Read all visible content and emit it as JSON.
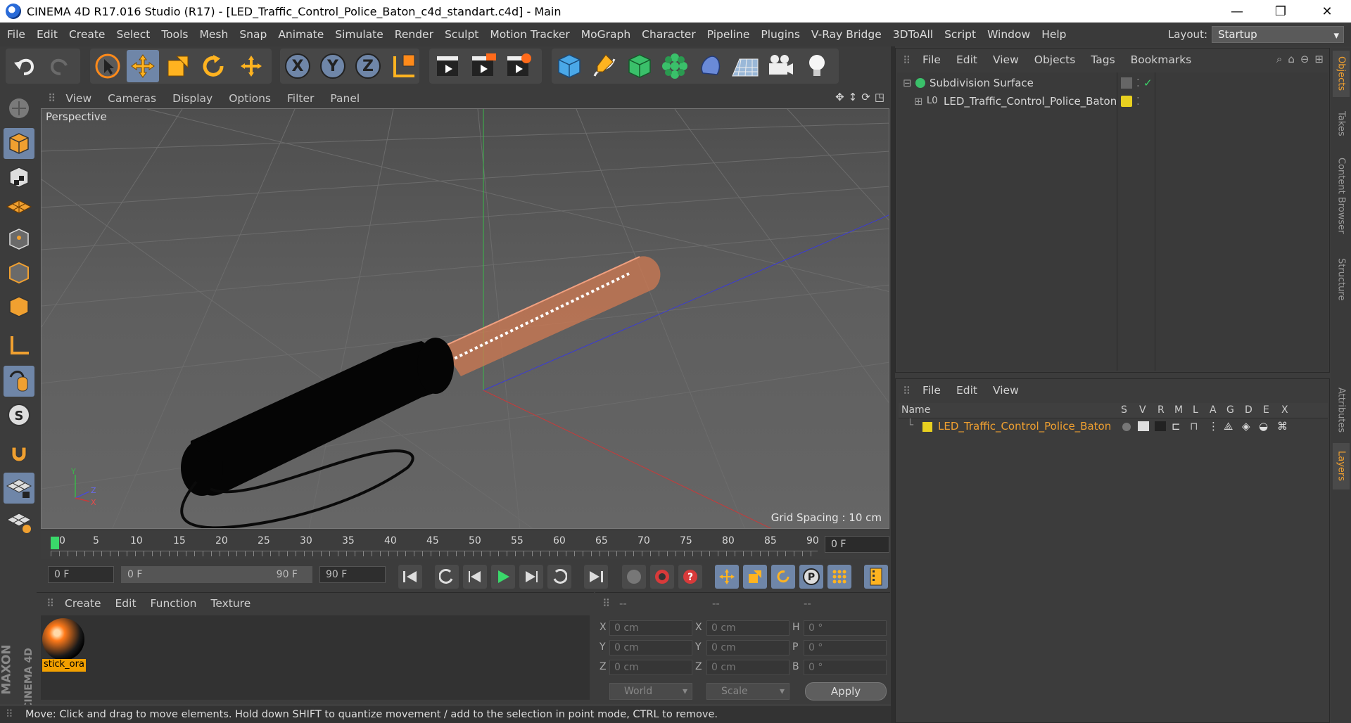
{
  "window": {
    "title": "CINEMA 4D R17.016 Studio (R17) - [LED_Traffic_Control_Police_Baton_c4d_standart.c4d] - Main",
    "minimize": "—",
    "maximize": "❐",
    "close": "✕"
  },
  "menubar": {
    "items": [
      "File",
      "Edit",
      "Create",
      "Select",
      "Tools",
      "Mesh",
      "Snap",
      "Animate",
      "Simulate",
      "Render",
      "Sculpt",
      "Motion Tracker",
      "MoGraph",
      "Character",
      "Pipeline",
      "Plugins",
      "V-Ray Bridge",
      "3DToAll",
      "Script",
      "Window",
      "Help"
    ],
    "layout_label": "Layout:",
    "layout_value": "Startup"
  },
  "toolbar": {
    "icons": [
      "undo-icon",
      "redo-icon",
      "live-selection-icon",
      "move-icon",
      "scale-icon",
      "rotate-icon",
      "recent-tool-icon",
      "x-axis-icon",
      "y-axis-icon",
      "z-axis-icon",
      "coordinate-system-icon",
      "render-view-icon",
      "render-picture-viewer-icon",
      "render-settings-icon",
      "cube-icon",
      "pen-spline-icon",
      "subdivision-icon",
      "cloner-icon",
      "deformer-icon",
      "floor-icon",
      "camera-icon",
      "light-icon"
    ],
    "x_label": "X",
    "y_label": "Y",
    "z_label": "Z"
  },
  "viewport": {
    "menu": [
      "View",
      "Cameras",
      "Display",
      "Options",
      "Filter",
      "Panel"
    ],
    "label": "Perspective",
    "grid_spacing": "Grid Spacing : 10 cm",
    "axis_y": "Y",
    "axis_z": "Z",
    "axis_x": "X"
  },
  "timeline": {
    "ticks": [
      "0",
      "5",
      "10",
      "15",
      "20",
      "25",
      "30",
      "35",
      "40",
      "45",
      "50",
      "55",
      "60",
      "65",
      "70",
      "75",
      "80",
      "85",
      "90"
    ],
    "current_frame": "0 F",
    "start_frame": "0 F",
    "range_start": "0 F",
    "range_end": "90 F",
    "end_frame": "90 F"
  },
  "material_manager": {
    "menu": [
      "Create",
      "Edit",
      "Function",
      "Texture"
    ],
    "material_name": "stick_ora"
  },
  "coordinates": {
    "headers": [
      "--",
      "--",
      "--"
    ],
    "rows": [
      {
        "l1": "X",
        "v1": "0 cm",
        "l2": "X",
        "v2": "0 cm",
        "l3": "H",
        "v3": "0 °"
      },
      {
        "l1": "Y",
        "v1": "0 cm",
        "l2": "Y",
        "v2": "0 cm",
        "l3": "P",
        "v3": "0 °"
      },
      {
        "l1": "Z",
        "v1": "0 cm",
        "l2": "Z",
        "v2": "0 cm",
        "l3": "B",
        "v3": "0 °"
      }
    ],
    "mode": "World",
    "transform": "Scale",
    "apply": "Apply"
  },
  "status": "Move: Click and drag to move elements. Hold down SHIFT to quantize movement / add to the selection in point mode, CTRL to remove.",
  "object_manager": {
    "menu": [
      "File",
      "Edit",
      "View",
      "Objects",
      "Tags",
      "Bookmarks"
    ],
    "objects": [
      {
        "name": "Subdivision Surface"
      },
      {
        "name": "LED_Traffic_Control_Police_Baton"
      }
    ]
  },
  "layer_manager": {
    "menu": [
      "File",
      "Edit",
      "View"
    ],
    "columns": [
      "Name",
      "S",
      "V",
      "R",
      "M",
      "L",
      "A",
      "G",
      "D",
      "E",
      "X"
    ],
    "layers": [
      {
        "name": "LED_Traffic_Control_Police_Baton",
        "color": "#e8d020"
      }
    ]
  },
  "right_tabs": [
    "Objects",
    "Takes",
    "Content Browser",
    "Structure",
    "Attributes",
    "Layers"
  ],
  "brand": {
    "line1": "MAXON",
    "line2": "CINEMA 4D"
  },
  "colors": {
    "accent": "#f0a030",
    "selected": "#6f86a8",
    "layer_yellow": "#e8d020",
    "baton_orange": "#e89060"
  }
}
